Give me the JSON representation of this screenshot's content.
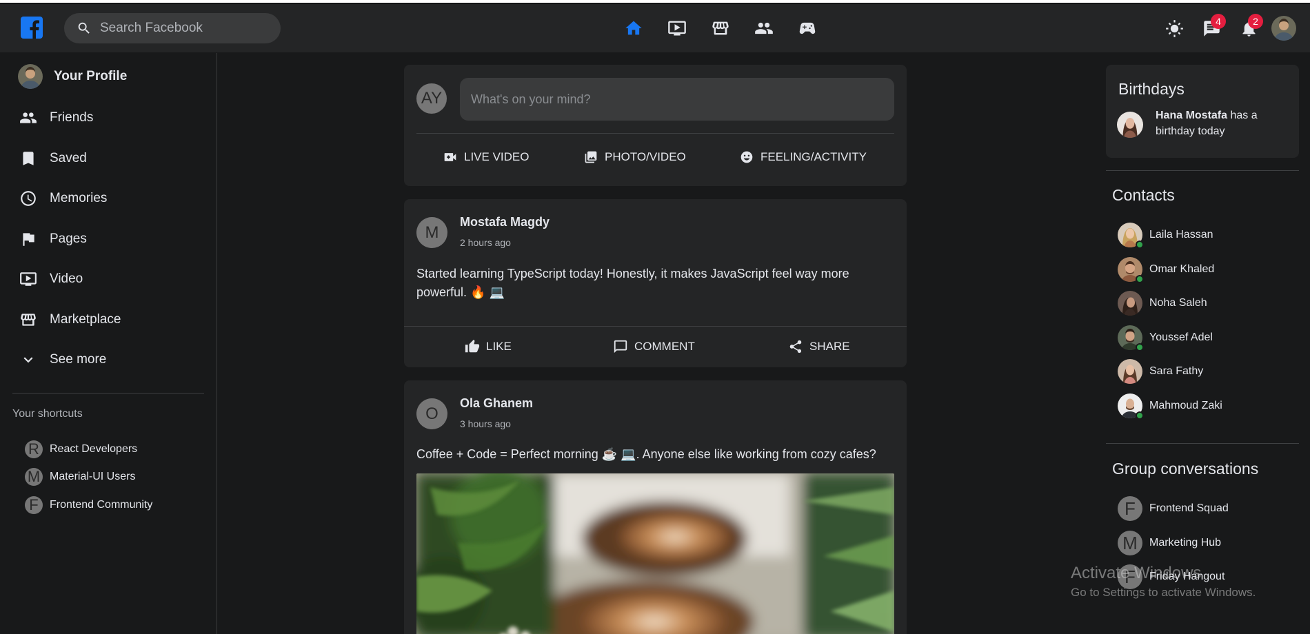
{
  "header": {
    "search_placeholder": "Search Facebook",
    "nav": [
      "home-icon",
      "video-icon",
      "marketplace-icon",
      "groups-icon",
      "gaming-icon"
    ],
    "messages_badge": "4",
    "notifications_badge": "2"
  },
  "sidebar": {
    "items": [
      {
        "label": "Your Profile"
      },
      {
        "label": "Friends"
      },
      {
        "label": "Saved"
      },
      {
        "label": "Memories"
      },
      {
        "label": "Pages"
      },
      {
        "label": "Video"
      },
      {
        "label": "Marketplace"
      },
      {
        "label": "See more"
      }
    ],
    "shortcuts_title": "Your shortcuts",
    "shortcuts": [
      {
        "initial": "R",
        "label": "React Developers"
      },
      {
        "initial": "M",
        "label": "Material-UI Users"
      },
      {
        "initial": "F",
        "label": "Frontend Community"
      }
    ]
  },
  "composer": {
    "initials": "AY",
    "placeholder": "What's on your mind?",
    "actions": [
      "LIVE VIDEO",
      "PHOTO/VIDEO",
      "FEELING/ACTIVITY"
    ]
  },
  "posts": [
    {
      "initial": "M",
      "author": "Mostafa Magdy",
      "time": "2 hours ago",
      "text": "Started learning TypeScript today! Honestly, it makes JavaScript feel way more powerful. 🔥 💻"
    },
    {
      "initial": "O",
      "author": "Ola Ghanem",
      "time": "3 hours ago",
      "text": "Coffee + Code = Perfect morning ☕ 💻. Anyone else like working from cozy cafes?"
    }
  ],
  "post_actions": [
    "LIKE",
    "COMMENT",
    "SHARE"
  ],
  "birthdays": {
    "title": "Birthdays",
    "name": "Hana Mostafa",
    "suffix": " has a birthday today"
  },
  "contacts": {
    "title": "Contacts",
    "items": [
      {
        "name": "Laila Hassan"
      },
      {
        "name": "Omar Khaled"
      },
      {
        "name": "Noha Saleh"
      },
      {
        "name": "Youssef Adel"
      },
      {
        "name": "Sara Fathy"
      },
      {
        "name": "Mahmoud Zaki"
      }
    ]
  },
  "groups": {
    "title": "Group conversations",
    "items": [
      {
        "initial": "F",
        "label": "Frontend Squad"
      },
      {
        "initial": "M",
        "label": "Marketing Hub"
      },
      {
        "initial": "F",
        "label": "Friday Hangout"
      }
    ]
  },
  "watermark": {
    "line1": "Activate Windows",
    "line2": "Go to Settings to activate Windows."
  },
  "colors": {
    "accent": "#1877f2",
    "background": "#18191a",
    "surface": "#242526",
    "badge": "#e41e3f",
    "online": "#31a24c"
  }
}
